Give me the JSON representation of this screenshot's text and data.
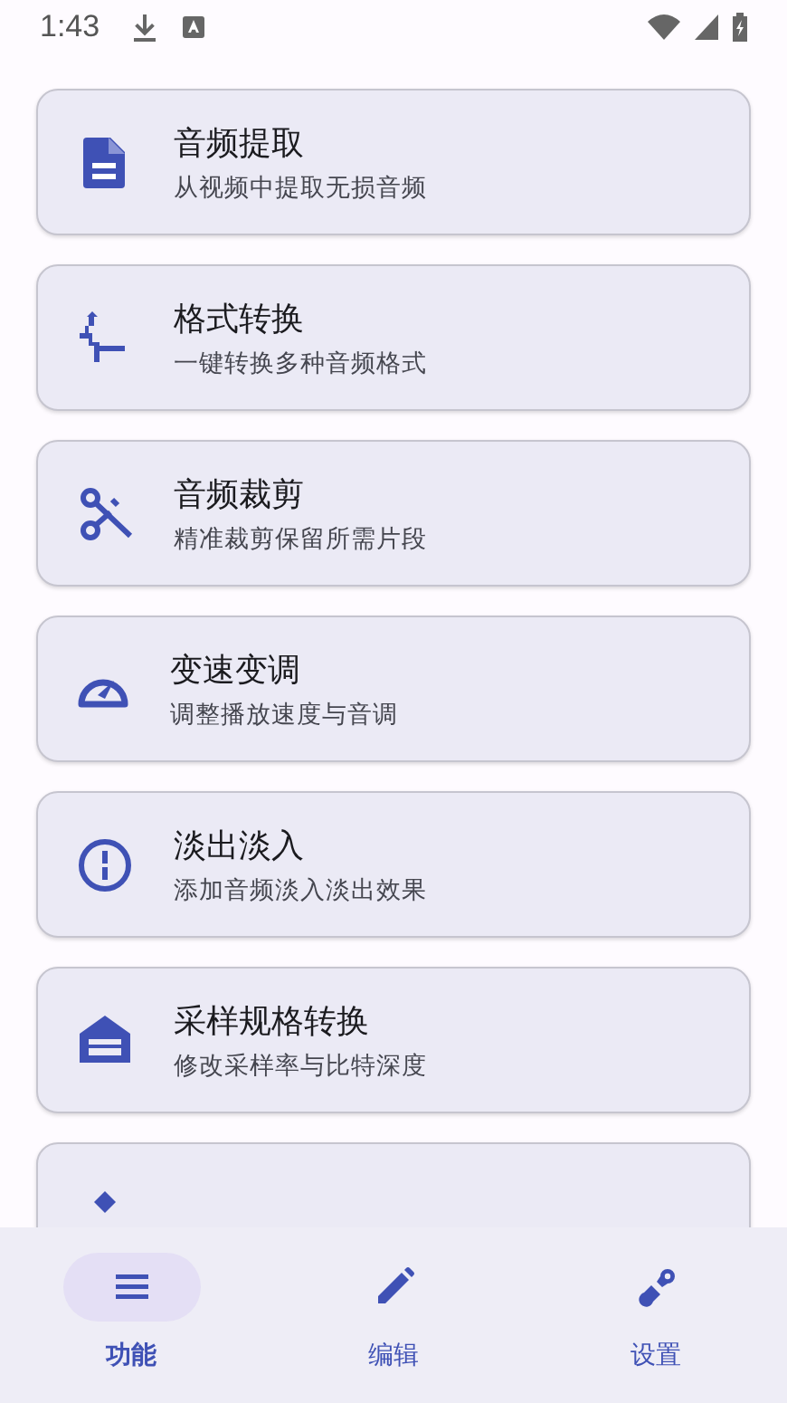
{
  "status_bar": {
    "time": "1:43"
  },
  "features": [
    {
      "title": "音频提取",
      "subtitle": "从视频中提取无损音频"
    },
    {
      "title": "格式转换",
      "subtitle": "一键转换多种音频格式"
    },
    {
      "title": "音频裁剪",
      "subtitle": "精准裁剪保留所需片段"
    },
    {
      "title": "变速变调",
      "subtitle": "调整播放速度与音调"
    },
    {
      "title": "淡出淡入",
      "subtitle": "添加音频淡入淡出效果"
    },
    {
      "title": "采样规格转换",
      "subtitle": "修改采样率与比特深度"
    }
  ],
  "bottom_nav": [
    {
      "label": "功能",
      "selected": true
    },
    {
      "label": "编辑",
      "selected": false
    },
    {
      "label": "设置",
      "selected": false
    }
  ]
}
